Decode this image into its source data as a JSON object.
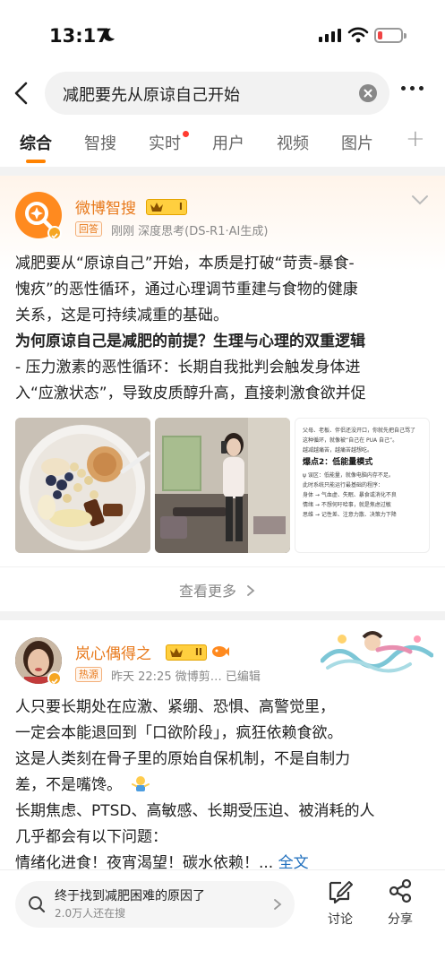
{
  "status": {
    "time": "13:17"
  },
  "search": {
    "query": "减肥要先从原谅自己开始"
  },
  "tabs": [
    {
      "label": "综合"
    },
    {
      "label": "智搜"
    },
    {
      "label": "实时"
    },
    {
      "label": "用户"
    },
    {
      "label": "视频"
    },
    {
      "label": "图片"
    }
  ],
  "tabs_more": "+",
  "card1": {
    "author": "微博智搜",
    "level_badge": "I",
    "tag": "回答",
    "meta": "刚刚  深度思考(DS-R1·AI生成)",
    "lines": [
      "减肥要从“原谅自己”开始，本质是打破“苛责-暴食-",
      "愧疚”的恶性循环，通过心理调节重建与食物的健康",
      "关系，这是可持续减重的基础。"
    ],
    "heading": "为何原谅自己是减肥的前提？生理与心理的双重逻辑",
    "lines2": [
      "- 压力激素的恶性循环：长期自我批判会触发身体进",
      "入“应激状态”，导致皮质醇升高，直接刺激食欲并促"
    ],
    "image3": {
      "t1": "父母、老板、伴侣还没开口，你就先把自己骂了",
      "t2": "这种循环，就像被“自己在 PUA 自己”。",
      "t3": "越减越痛苦，越痛苦越想吃。",
      "h1": "爆点2：低能量模式",
      "t4": "ψ 误区：低能量，就像电脑内存不足。",
      "t5": "此时系统只能运行最基础的程序：",
      "t6": "身体 → 气血虚、失眠、暴食或消化不良",
      "t7": "情绪 → 不想何吁哈事，就是焦虑过敏",
      "t8": "思维 → 记性差、注意力散、决策力下降"
    },
    "see_more": "查看更多"
  },
  "card2": {
    "author": "岚心偶得之",
    "level_badge": "II",
    "tag": "热源",
    "meta": "昨天 22:25  微博剪…  已编辑",
    "lines": [
      "人只要长期处在应激、紧绷、恐惧、高警觉里，",
      "一定会本能退回到「口欲阶段」，疯狂依赖食欲。",
      "这是人类刻在骨子里的原始自保机制，不是自制力",
      "差，不是嘴馋。",
      "长期焦虑、PTSD、高敏感、长期受压迫、被消耗的人",
      "几乎都会有以下问题："
    ],
    "last_line": "情绪化进食！夜宵渴望！碳水依赖！...",
    "full_text": "全文"
  },
  "bottom": {
    "hot_title": "终于找到减肥困难的原因了",
    "hot_sub": "2.0万人还在搜",
    "discuss": "讨论",
    "share": "分享"
  }
}
